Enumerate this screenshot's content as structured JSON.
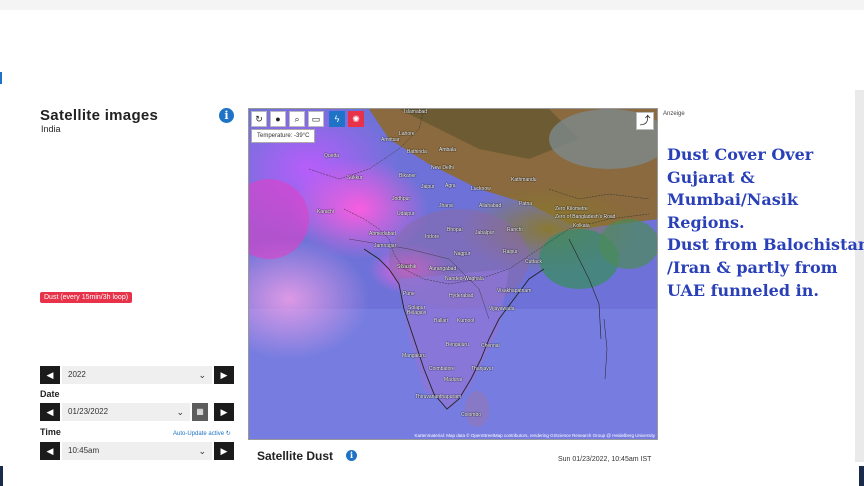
{
  "page": {
    "title": "Satellite images",
    "region": "India",
    "layer_badge": "Dust (every 15min/3h loop)",
    "info_icon": "info-icon",
    "anzeige": "Anzeige"
  },
  "controls": {
    "year": "2022",
    "date_label": "Date",
    "date": "01/23/2022",
    "time_label": "Time",
    "auto_update": "Auto-Update active",
    "time": "10:45am",
    "prev": "◀",
    "next": "▶"
  },
  "map": {
    "temperature": "Temperature:  -39°C",
    "attribution": "Kartenmaterial: Map data © OpenStreetMap contributors, rendering GIScience Research Group @ Heidelberg University",
    "cities": [
      "Islamabad",
      "Lahore",
      "Amritsar",
      "Ambala",
      "Quetta",
      "Bathinda",
      "New Delhi",
      "Sukkur",
      "Bikaner",
      "Kathmandu",
      "Jaipur",
      "Agra",
      "Lucknow",
      "Jodhpur",
      "Patna",
      "Jhansi",
      "Allahabad",
      "Udaipur",
      "Karachi",
      "Bhopal",
      "Ranchi",
      "Ahmedabad",
      "Indore",
      "Jabalpur",
      "Kolkata",
      "Jamnagar",
      "Nagpur",
      "Surat",
      "Raipur",
      "Cuttack",
      "Nashik",
      "Aurangabad",
      "Pune",
      "Nanded-Waghala",
      "Solapur",
      "Visakhapatnam",
      "Hyderabad",
      "Belagavi",
      "Vijayawada",
      "Ballari",
      "Kurnool",
      "Bengaluru",
      "Chennai",
      "Mangaluru",
      "Coimbatore",
      "Thanjavur",
      "Madurai",
      "Thiruvananthapuram",
      "Colombo"
    ],
    "highlight_labels": [
      "Zero Kilometre",
      "Zero of Bangladesh's Road"
    ]
  },
  "annotation": {
    "lines": [
      "Dust Cover Over",
      "Gujarat &",
      "Mumbai/Nasik",
      "Regions.",
      "Dust from Balochistan",
      "/Iran & partly from",
      "UAE funneled in."
    ]
  },
  "footer": {
    "caption": "Satellite Dust",
    "timestamp": "Sun 01/23/2022, 10:45am IST"
  },
  "colors": {
    "accent": "#1f73c6",
    "badge": "#e8324a",
    "annotation_text": "#2a40b8"
  }
}
